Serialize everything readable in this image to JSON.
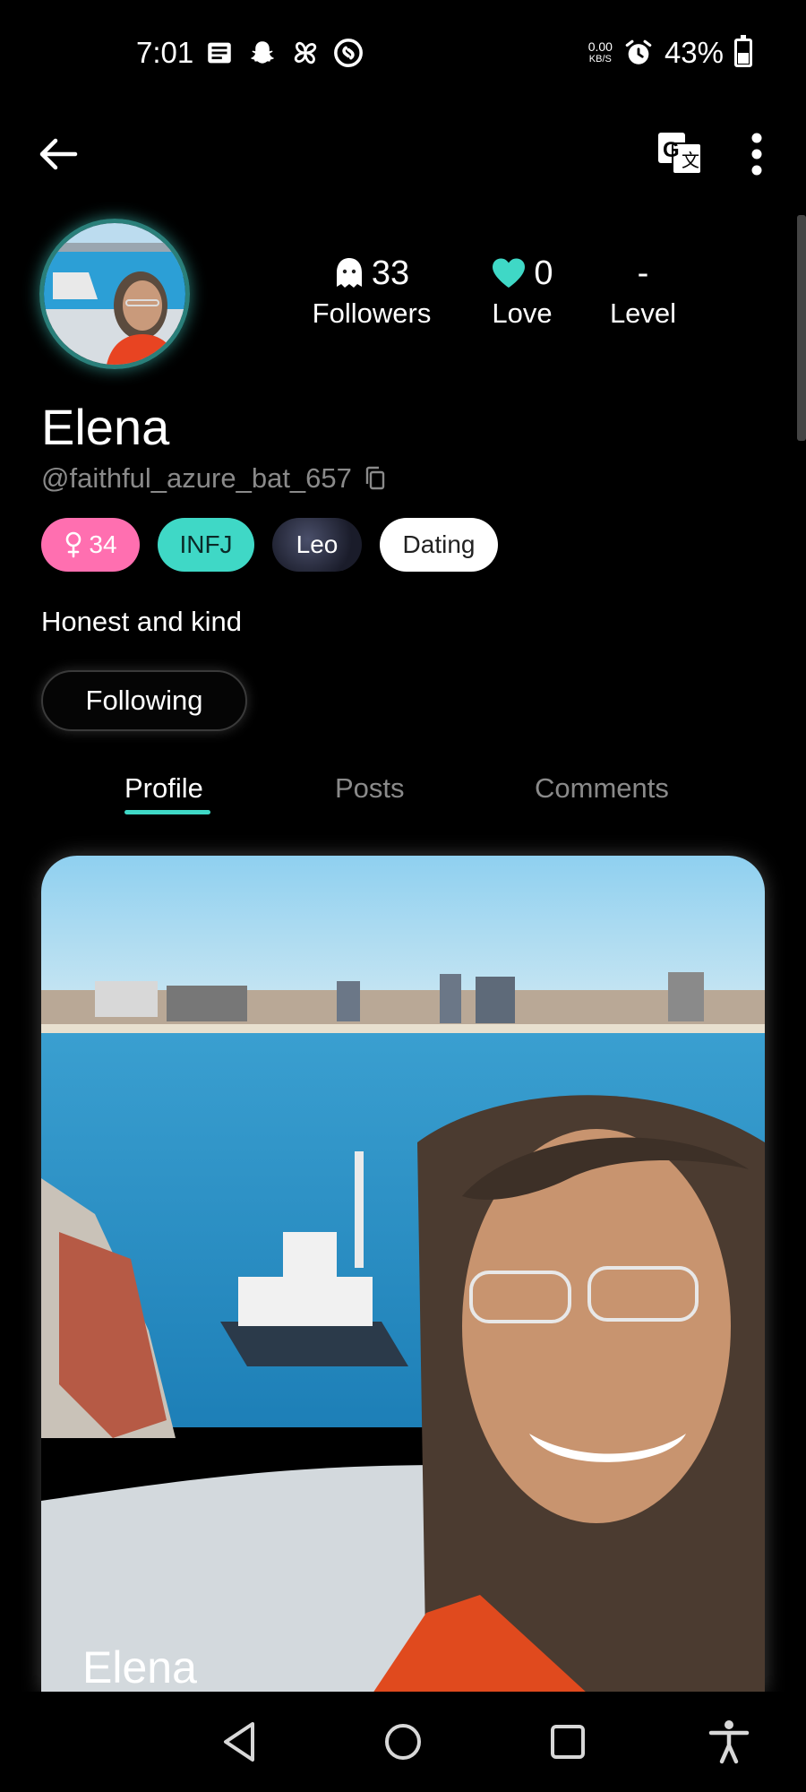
{
  "status_bar": {
    "time": "7:01",
    "speed_top": "0.00",
    "speed_unit": "KB/S",
    "battery": "43%",
    "left_icons": [
      "news-icon",
      "snapchat-icon",
      "pinwheel-icon",
      "shazam-icon"
    ],
    "right_icons": [
      "alarm-icon",
      "battery-icon"
    ]
  },
  "app_bar": {
    "icons": [
      "back-arrow-icon",
      "translate-icon",
      "more-vert-icon"
    ]
  },
  "profile": {
    "stats": {
      "followers": {
        "value": "33",
        "label": "Followers",
        "icon": "ghost-icon"
      },
      "love": {
        "value": "0",
        "label": "Love",
        "icon": "heart-icon",
        "color": "#3fd8c6"
      },
      "level": {
        "value": "-",
        "label": "Level"
      }
    },
    "name": "Elena",
    "handle": "@faithful_azure_bat_657",
    "tags": {
      "age": "34",
      "mbti": "INFJ",
      "zodiac": "Leo",
      "intent": "Dating"
    },
    "bio": "Honest and kind",
    "follow_button": "Following"
  },
  "tabs": [
    {
      "label": "Profile",
      "active": true
    },
    {
      "label": "Posts",
      "active": false
    },
    {
      "label": "Comments",
      "active": false
    }
  ],
  "photo_card": {
    "caption": "Elena"
  },
  "colors": {
    "accent": "#3fd8c6",
    "age_tag": "#ff6fb0",
    "background": "#000000"
  }
}
